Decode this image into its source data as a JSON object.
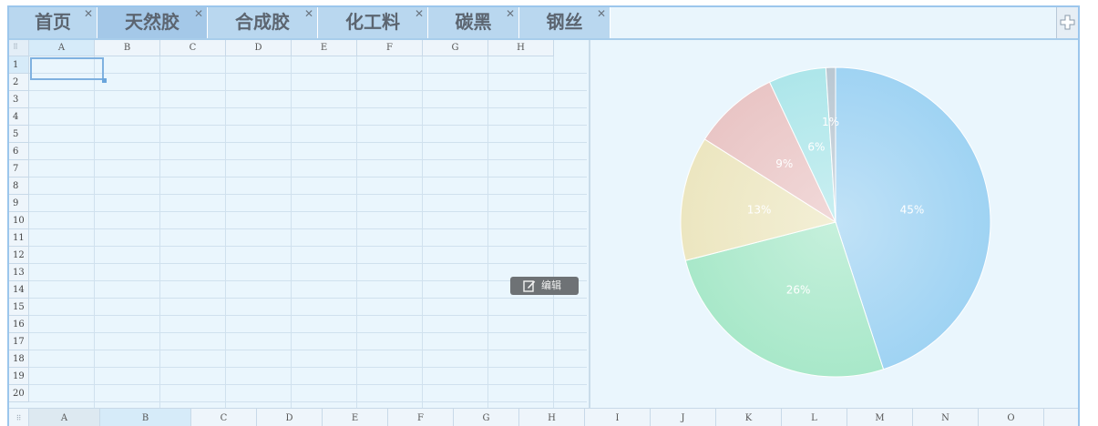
{
  "tabs": [
    {
      "label": "首页",
      "close": "✕"
    },
    {
      "label": "天然胶",
      "close": "✕"
    },
    {
      "label": "合成胶",
      "close": "✕"
    },
    {
      "label": "化工料",
      "close": "✕"
    },
    {
      "label": "碳黑",
      "close": "✕"
    },
    {
      "label": "钢丝",
      "close": "✕"
    }
  ],
  "sheet": {
    "corner_glyph": "⠿",
    "columns": [
      "A",
      "B",
      "C",
      "D",
      "E",
      "F",
      "G",
      "H"
    ],
    "rows": [
      "1",
      "2",
      "3",
      "4",
      "5",
      "6",
      "7",
      "8",
      "9",
      "10",
      "11",
      "12",
      "13",
      "14",
      "15",
      "16",
      "17",
      "18",
      "19",
      "20"
    ],
    "selected_cell": "A1"
  },
  "edit_button": {
    "label": "编辑",
    "icon": "edit-icon"
  },
  "bottom_bar": {
    "corner_glyph": "⠿",
    "columns": [
      "A",
      "B",
      "C",
      "D",
      "E",
      "F",
      "G",
      "H",
      "I",
      "J",
      "K",
      "L",
      "M",
      "N",
      "O"
    ]
  },
  "chart_data": {
    "type": "pie",
    "title": "",
    "slices": [
      {
        "label": "45%",
        "value": 45,
        "color": "#9fd3f3"
      },
      {
        "label": "26%",
        "value": 26,
        "color": "#a8e8c9"
      },
      {
        "label": "13%",
        "value": 13,
        "color": "#ece6c0"
      },
      {
        "label": "9%",
        "value": 9,
        "color": "#e9c5c5"
      },
      {
        "label": "6%",
        "value": 6,
        "color": "#ade6ea"
      },
      {
        "label": "1%",
        "value": 1,
        "color": "#b9c7d2"
      }
    ],
    "legend": "none"
  },
  "colors": {
    "tab_bg": "#b9d7ef",
    "tab_active_bg": "#a4c8e8",
    "panel_bg": "#eaf6fd",
    "border": "#9cc6ec"
  }
}
